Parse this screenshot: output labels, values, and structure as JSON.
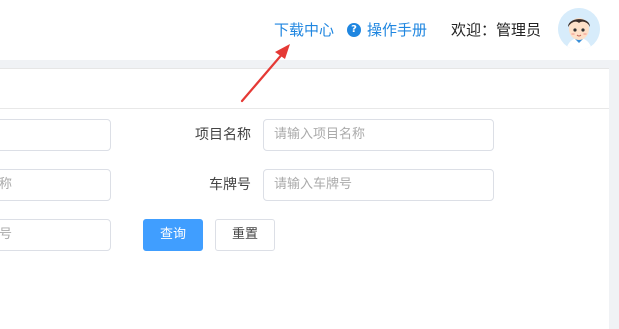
{
  "header": {
    "download_label": "下载中心",
    "manual_label": "操作手册",
    "help_icon_glyph": "?",
    "welcome_text": "欢迎：管理员"
  },
  "form": {
    "row1_left_partial": "",
    "project_name_label": "项目名称",
    "project_name_placeholder": "请输入项目名称",
    "row2_left_partial": "称",
    "plate_label": "车牌号",
    "plate_placeholder": "请输入车牌号",
    "row3_left_partial": "号"
  },
  "buttons": {
    "query_label": "查询",
    "reset_label": "重置"
  },
  "colors": {
    "link_blue": "#1f86e0",
    "primary_button": "#409eff",
    "annotation_arrow": "#e53935"
  }
}
